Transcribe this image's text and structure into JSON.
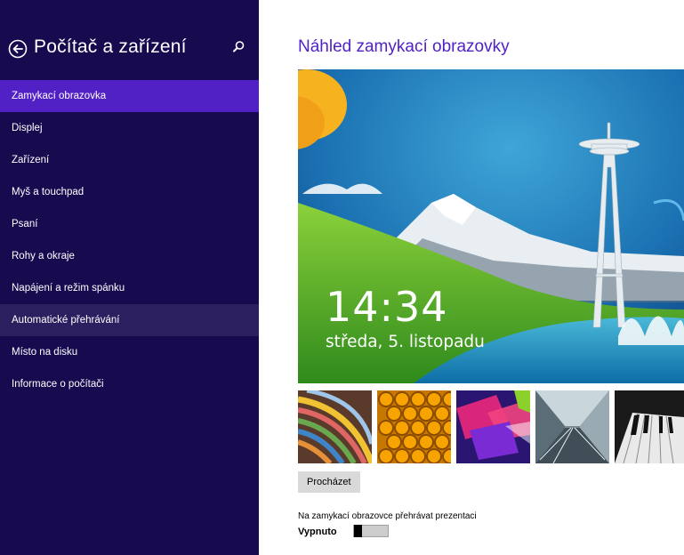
{
  "sidebar": {
    "title": "Počítač a zařízení",
    "back_icon": "back-arrow-icon",
    "search_icon": "search-icon",
    "items": [
      {
        "label": "Zamykací obrazovka",
        "state": "selected"
      },
      {
        "label": "Displej",
        "state": "normal"
      },
      {
        "label": "Zařízení",
        "state": "normal"
      },
      {
        "label": "Myš a touchpad",
        "state": "normal"
      },
      {
        "label": "Psaní",
        "state": "normal"
      },
      {
        "label": "Rohy a okraje",
        "state": "normal"
      },
      {
        "label": "Napájení a režim spánku",
        "state": "normal"
      },
      {
        "label": "Automatické přehrávání",
        "state": "hover"
      },
      {
        "label": "Místo na disku",
        "state": "normal"
      },
      {
        "label": "Informace o počítači",
        "state": "normal"
      }
    ]
  },
  "main": {
    "preview_title": "Náhled zamykací obrazovky",
    "clock": {
      "time": "14:34",
      "date": "středa, 5. listopadu"
    },
    "browse_label": "Procházet",
    "slideshow": {
      "label": "Na zamykací obrazovce přehrávat prezentaci",
      "state": "Vypnuto",
      "on": false
    }
  },
  "colors": {
    "sidebar_bg": "#170a4f",
    "accent": "#5121c6",
    "hover": "#2b1f5f"
  }
}
